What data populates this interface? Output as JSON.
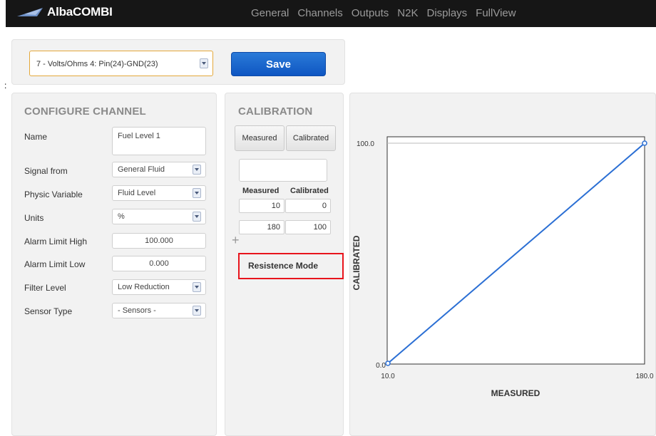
{
  "app": {
    "name": "AlbaCOMBI"
  },
  "nav": [
    "General",
    "Channels",
    "Outputs",
    "N2K",
    "Displays",
    "FullView"
  ],
  "stray_colon": ":",
  "toolbar": {
    "channel_selected": "7 - Volts/Ohms 4: Pin(24)-GND(23)",
    "save_label": "Save"
  },
  "configure": {
    "title": "CONFIGURE CHANNEL",
    "rows": [
      {
        "label": "Name",
        "value": "Fuel Level 1",
        "kind": "text"
      },
      {
        "label": "Signal from",
        "value": "General Fluid",
        "kind": "select"
      },
      {
        "label": "Physic Variable",
        "value": "Fluid Level",
        "kind": "select"
      },
      {
        "label": "Units",
        "value": "%",
        "kind": "select"
      },
      {
        "label": "Alarm Limit High",
        "value": "100.000",
        "kind": "number"
      },
      {
        "label": "Alarm Limit Low",
        "value": "0.000",
        "kind": "number"
      },
      {
        "label": "Filter Level",
        "value": "Low Reduction",
        "kind": "select"
      },
      {
        "label": "Sensor Type",
        "value": "- Sensors -",
        "kind": "select"
      }
    ]
  },
  "calibration": {
    "title": "CALIBRATION",
    "measured_button": "Measured",
    "calibrated_button": "Calibrated",
    "input_value": "",
    "headers": {
      "measured": "Measured",
      "calibrated": "Calibrated"
    },
    "rows": [
      {
        "measured": "10",
        "calibrated": "0"
      },
      {
        "measured": "180",
        "calibrated": "100"
      }
    ],
    "add_icon": "+",
    "mode_button": "Resistence Mode"
  },
  "chart_data": {
    "type": "line",
    "xlabel": "MEASURED",
    "ylabel": "CALIBRATED",
    "xlim": [
      10,
      180
    ],
    "ylim": [
      0,
      100
    ],
    "x_ticks": [
      "10.0",
      "180.0"
    ],
    "y_ticks": [
      "100.0",
      "0.0"
    ],
    "grid": false,
    "series": [
      {
        "x": [
          10,
          180
        ],
        "y": [
          0,
          100
        ]
      }
    ],
    "line_color": "#2b6fd4"
  }
}
